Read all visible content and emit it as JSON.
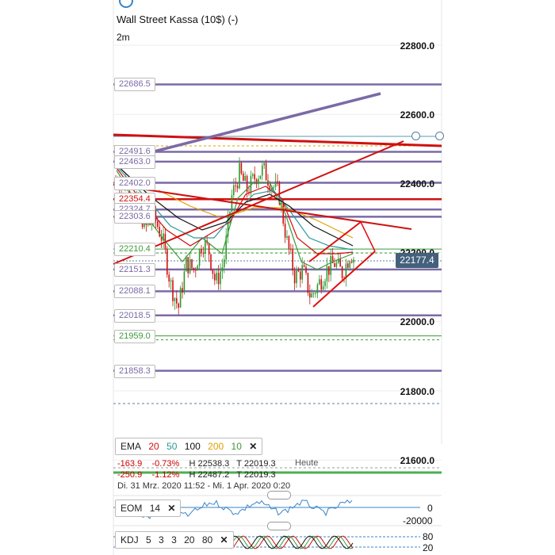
{
  "header": {
    "title": "Wall Street Kassa (10$) (-)",
    "interval": "2m"
  },
  "price_axis": [
    "22800.0",
    "22600.0",
    "22400.0",
    "22200.0",
    "22000.0",
    "21800.0",
    "21600.0"
  ],
  "current_price": "22177.4",
  "levels": [
    {
      "label": "22686.5",
      "color": "#7b6aa6"
    },
    {
      "label": "22491.6",
      "color": "#7b6aa6"
    },
    {
      "label": "22463.0",
      "color": "#7b6aa6"
    },
    {
      "label": "22402.0",
      "color": "#7b6aa6"
    },
    {
      "label": "22354.4",
      "color": "#d01010"
    },
    {
      "label": "22324.7",
      "color": "#7b6aa6"
    },
    {
      "label": "22303.6",
      "color": "#7b6aa6"
    },
    {
      "label": "22210.4",
      "color": "#3a9a3a"
    },
    {
      "label": "22151.3",
      "color": "#7b6aa6"
    },
    {
      "label": "22088.1",
      "color": "#7b6aa6"
    },
    {
      "label": "22018.5",
      "color": "#7b6aa6"
    },
    {
      "label": "21959.0",
      "color": "#3a9a3a"
    },
    {
      "label": "21858.3",
      "color": "#7b6aa6"
    }
  ],
  "ema_legend": {
    "name": "EMA",
    "periods": [
      {
        "value": "20",
        "color": "#d01010"
      },
      {
        "value": "50",
        "color": "#2a9a9a"
      },
      {
        "value": "100",
        "color": "#111111"
      },
      {
        "value": "200",
        "color": "#e0a000"
      },
      {
        "value": "10",
        "color": "#3a9a3a"
      }
    ],
    "close": "✕"
  },
  "stats": {
    "row1": {
      "change": "-163.9",
      "pct": "-0.73%",
      "high": "H 22538.3",
      "low": "T 22019.3"
    },
    "row2": {
      "change": "-250.9",
      "pct": "-1.12%",
      "high": "H 22487.2",
      "low": "T 22019.3"
    },
    "heute": "Heute",
    "period": "Di. 31 Mrz. 2020 11:52 - Mi. 1 Apr. 2020 0:20"
  },
  "eom": {
    "name": "EOM",
    "param": "14",
    "close": "✕",
    "axis": [
      "0",
      "-20000"
    ]
  },
  "kdj": {
    "name": "KDJ",
    "params": [
      "5",
      "3",
      "3",
      "20",
      "80"
    ],
    "close": "✕",
    "axis": [
      "80",
      "20"
    ]
  },
  "colors": {
    "up": "#2a9a2a",
    "down": "#d01010",
    "level": "#7b6aa6",
    "trend": "#e01010",
    "price_tag": "#44607c"
  }
}
